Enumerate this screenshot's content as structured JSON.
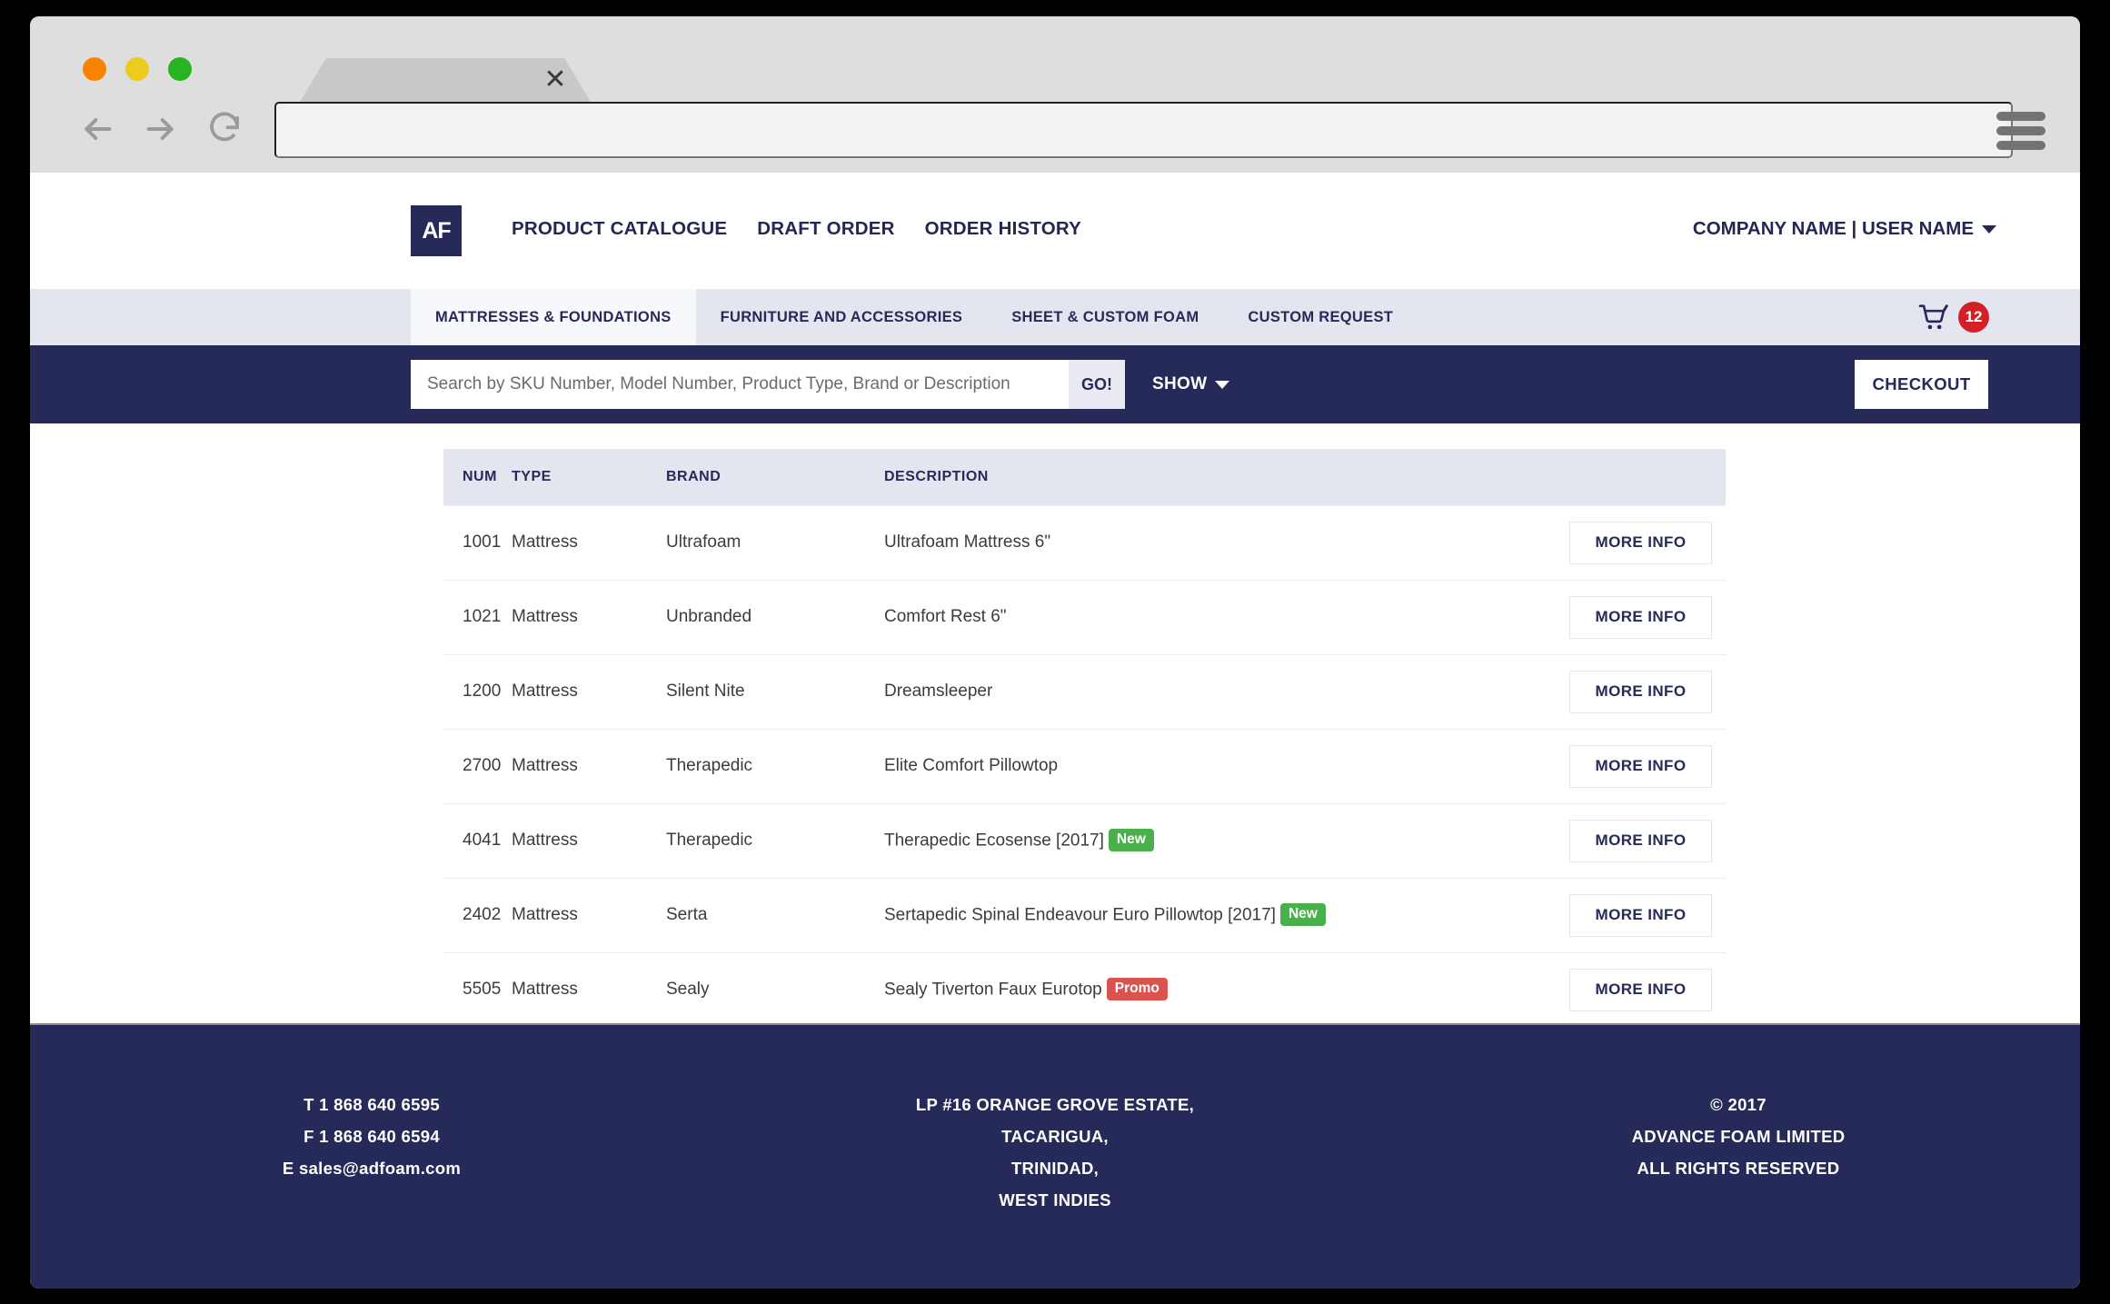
{
  "browser": {
    "tab_close_label": "✕",
    "url_value": "",
    "url_placeholder": "",
    "back_icon": "back-arrow-icon",
    "forward_icon": "forward-arrow-icon",
    "reload_icon": "reload-icon",
    "menu_icon": "hamburger-menu-icon"
  },
  "header": {
    "logo_text": "AF",
    "nav": [
      {
        "label": "PRODUCT CATALOGUE"
      },
      {
        "label": "DRAFT ORDER"
      },
      {
        "label": "ORDER HISTORY"
      }
    ],
    "user_label": "COMPANY NAME | USER NAME"
  },
  "categories": {
    "items": [
      {
        "label": "MATTRESSES & FOUNDATIONS",
        "active": true
      },
      {
        "label": "FURNITURE AND ACCESSORIES",
        "active": false
      },
      {
        "label": "SHEET & CUSTOM FOAM",
        "active": false
      },
      {
        "label": "CUSTOM REQUEST",
        "active": false
      }
    ],
    "cart_count": "12"
  },
  "search": {
    "value": "",
    "placeholder": "Search by SKU Number, Model Number, Product Type, Brand or Description",
    "go_label": "GO!",
    "show_label": "SHOW",
    "checkout_label": "CHECKOUT"
  },
  "table": {
    "columns": [
      "NUM",
      "TYPE",
      "BRAND",
      "DESCRIPTION"
    ],
    "action_label": "MORE INFO",
    "rows": [
      {
        "num": "1001",
        "type": "Mattress",
        "brand": "Ultrafoam",
        "desc": "Ultrafoam Mattress 6\"",
        "badge": "",
        "badge_type": ""
      },
      {
        "num": "1021",
        "type": "Mattress",
        "brand": "Unbranded",
        "desc": "Comfort Rest 6\"",
        "badge": "",
        "badge_type": ""
      },
      {
        "num": "1200",
        "type": "Mattress",
        "brand": "Silent Nite",
        "desc": "Dreamsleeper",
        "badge": "",
        "badge_type": ""
      },
      {
        "num": "2700",
        "type": "Mattress",
        "brand": "Therapedic",
        "desc": "Elite Comfort Pillowtop",
        "badge": "",
        "badge_type": ""
      },
      {
        "num": "4041",
        "type": "Mattress",
        "brand": "Therapedic",
        "desc": "Therapedic Ecosense [2017]",
        "badge": "New",
        "badge_type": "new"
      },
      {
        "num": "2402",
        "type": "Mattress",
        "brand": "Serta",
        "desc": "Sertapedic Spinal Endeavour Euro Pillowtop [2017]",
        "badge": "New",
        "badge_type": "new"
      },
      {
        "num": "5505",
        "type": "Mattress",
        "brand": "Sealy",
        "desc": "Sealy Tiverton Faux Eurotop",
        "badge": "Promo",
        "badge_type": "promo"
      }
    ]
  },
  "footer": {
    "col1": [
      "T 1 868 640 6595",
      "F 1 868 640 6594",
      "E sales@adfoam.com"
    ],
    "col2": [
      "LP #16 ORANGE GROVE ESTATE,",
      "TACARIGUA,",
      "TRINIDAD,",
      "WEST INDIES"
    ],
    "col3": [
      "© 2017",
      "ADVANCE FOAM LIMITED",
      "ALL RIGHTS RESERVED"
    ]
  },
  "colors": {
    "navy": "#262a58",
    "light_lavender": "#e3e6ef",
    "badge_new": "#49b04c",
    "badge_promo": "#d9534f",
    "cart_badge": "#d32027"
  }
}
